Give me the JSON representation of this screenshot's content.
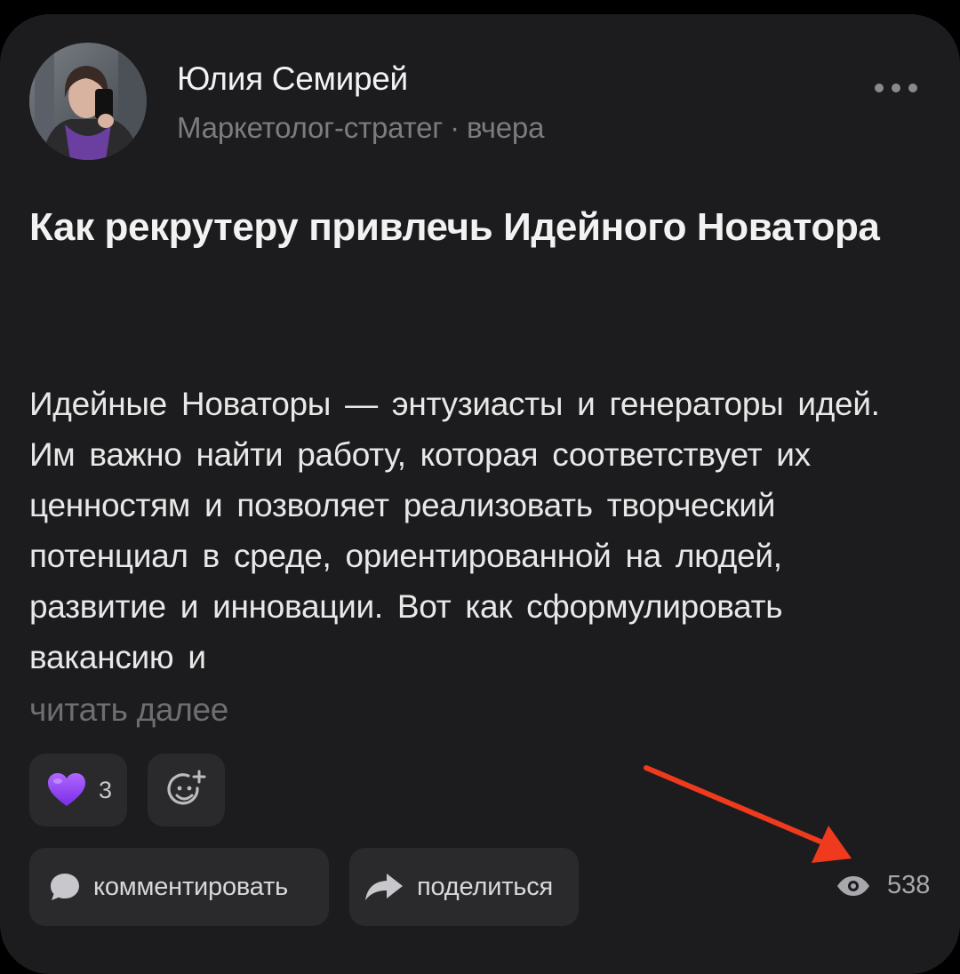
{
  "author": {
    "name": "Юлия Семирей",
    "role": "Маркетолог-стратег",
    "separator": "·",
    "time": "вчера"
  },
  "post": {
    "title": "Как рекрутеру привлечь Идейного Новатора",
    "body": "Идейные Новаторы — энтузиасты и генераторы идей. Им важно найти работу, которая соответствует их ценностям и позволяет реализовать творческий потенциал в среде, ориентированной на людей, развитие и инновации. Вот как сформулировать вакансию и",
    "read_more": "читать далее"
  },
  "reactions": {
    "like_icon": "purple-heart-icon",
    "like_color": "#9b4dff",
    "like_count": "3",
    "add_reaction_icon": "add-emoji-icon"
  },
  "actions": {
    "comment_label": "комментировать",
    "comment_icon": "speech-bubble-icon",
    "share_label": "поделиться",
    "share_icon": "share-arrow-icon"
  },
  "stats": {
    "views_icon": "eye-icon",
    "views": "538"
  },
  "colors": {
    "background": "#000000",
    "card": "#1c1c1e",
    "pill": "#2a2a2c",
    "annotation_arrow": "#f03a1e"
  }
}
